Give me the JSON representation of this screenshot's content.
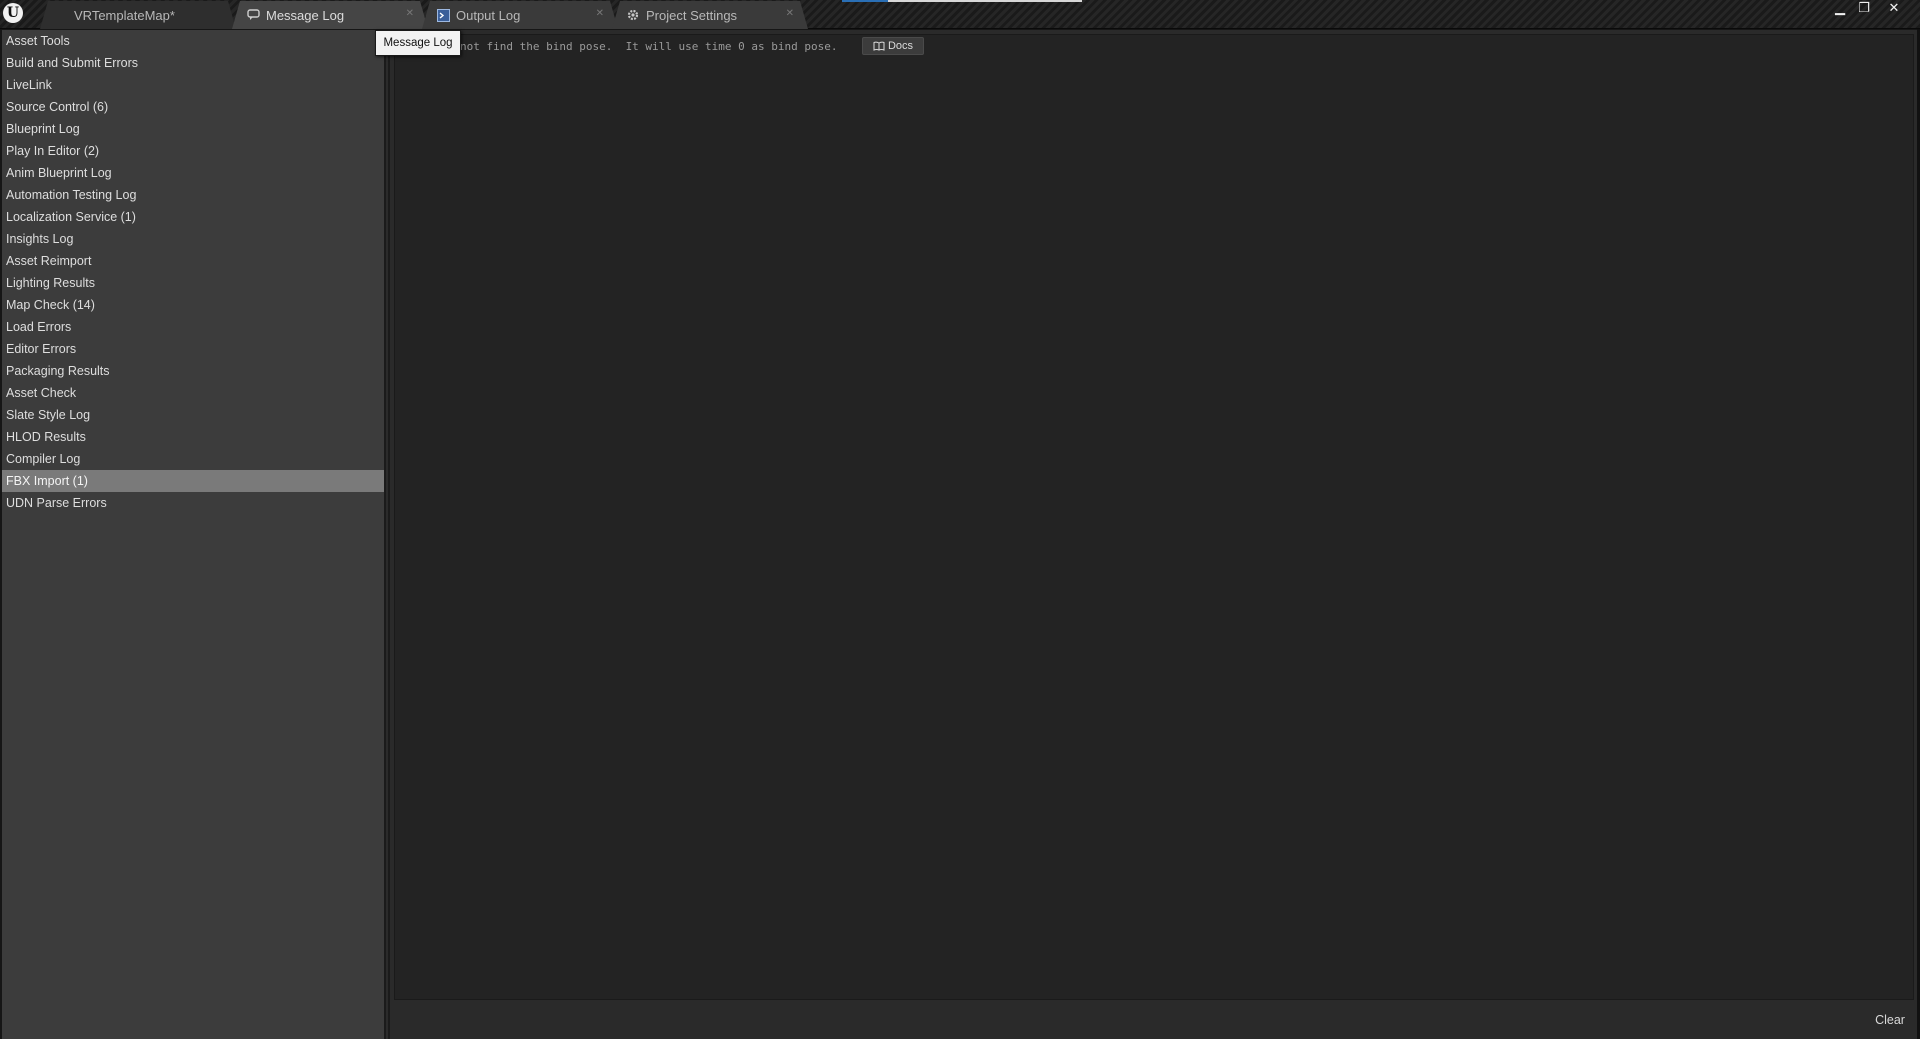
{
  "app": {
    "logo_letter": "U",
    "tabs": [
      {
        "label": "VRTemplateMap*",
        "icon": "level-icon",
        "active": false
      },
      {
        "label": "Message Log",
        "icon": "message-log-icon",
        "active": true
      },
      {
        "label": "Output Log",
        "icon": "output-log-icon",
        "active": false
      },
      {
        "label": "Project Settings",
        "icon": "settings-gear-icon",
        "active": false
      }
    ],
    "window_controls": {
      "minimize": "▁",
      "restore": "❐",
      "close": "✕"
    }
  },
  "sidebar": {
    "items": [
      {
        "label": "Asset Tools"
      },
      {
        "label": "Build and Submit Errors"
      },
      {
        "label": "LiveLink"
      },
      {
        "label": "Source Control (6)"
      },
      {
        "label": "Blueprint Log"
      },
      {
        "label": "Play In Editor (2)"
      },
      {
        "label": "Anim Blueprint Log"
      },
      {
        "label": "Automation Testing Log"
      },
      {
        "label": "Localization Service (1)"
      },
      {
        "label": "Insights Log"
      },
      {
        "label": "Asset Reimport"
      },
      {
        "label": "Lighting Results"
      },
      {
        "label": "Map Check (14)"
      },
      {
        "label": "Load Errors"
      },
      {
        "label": "Editor Errors"
      },
      {
        "label": "Packaging Results"
      },
      {
        "label": "Asset Check"
      },
      {
        "label": "Slate Style Log"
      },
      {
        "label": "HLOD Results"
      },
      {
        "label": "Compiler Log"
      },
      {
        "label": "FBX Import (1)",
        "selected": true
      },
      {
        "label": "UDN Parse Errors"
      }
    ]
  },
  "log": {
    "message": "not find the bind pose.  It will use time 0 as bind pose.",
    "docs_label": "Docs"
  },
  "tooltip": {
    "text": "Message Log"
  },
  "footer": {
    "clear_label": "Clear"
  },
  "colors": {
    "selected_row": "#7a7a7a",
    "accent": "#2a6fb5"
  }
}
